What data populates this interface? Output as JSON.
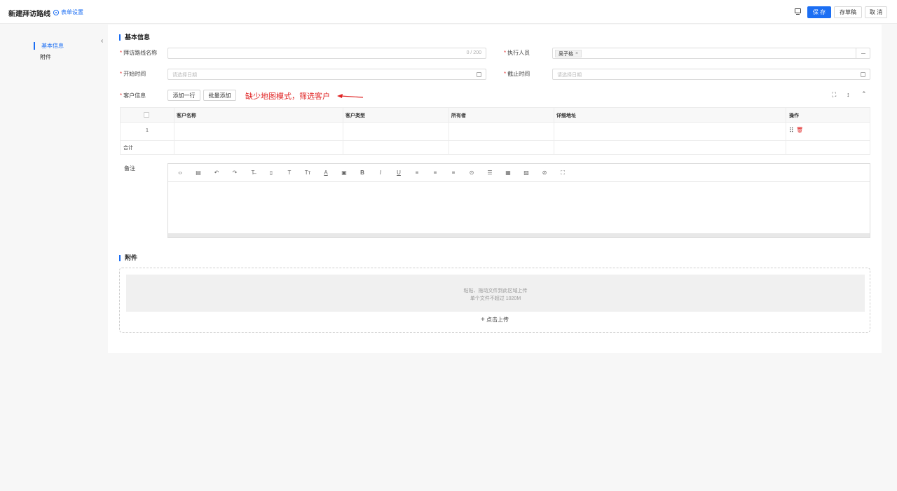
{
  "header": {
    "title": "新建拜访路线",
    "form_settings": "表单设置",
    "save": "保 存",
    "draft": "存草稿",
    "cancel": "取 消"
  },
  "nav": {
    "items": [
      {
        "label": "基本信息",
        "active": true
      },
      {
        "label": "附件",
        "active": false
      }
    ]
  },
  "basic": {
    "section_title": "基本信息",
    "route_name_label": "拜访路线名称",
    "route_name_counter": "0 / 200",
    "executor_label": "执行人员",
    "executor_tag": "吴子格",
    "executor_more": "···",
    "start_label": "开始时间",
    "start_placeholder": "请选择日期",
    "end_label": "截止时间",
    "end_placeholder": "请选择日期",
    "customer_label": "客户信息",
    "add_row": "添加一行",
    "batch_add": "批量添加",
    "annotation": "缺少地图模式，筛选客户"
  },
  "table": {
    "columns": [
      "客户名称",
      "客户类型",
      "所有者",
      "详细地址",
      "操作"
    ],
    "row_index": "1",
    "total_label": "合计"
  },
  "remark": {
    "label": "备注",
    "toolbar": [
      "code-icon",
      "table-icon",
      "undo-icon",
      "redo-icon",
      "strikethrough-icon",
      "paste-icon",
      "text-icon",
      "font-size-icon",
      "font-color-icon",
      "bg-color-icon",
      "bold-icon",
      "italic-icon",
      "underline-icon",
      "align-left-icon",
      "align-center-icon",
      "align-right-icon",
      "list-icon",
      "indent-icon",
      "grid-icon",
      "image-icon",
      "attach-icon",
      "fullscreen-icon"
    ]
  },
  "attachment": {
    "section_title": "附件",
    "drop_hint": "粘贴、拖动文件到此区域上传",
    "size_hint": "单个文件不超过 1020M",
    "upload_label": "点击上传"
  },
  "colors": {
    "accent": "#1b6ef3",
    "required": "#e54545",
    "annotation": "#e02424"
  }
}
